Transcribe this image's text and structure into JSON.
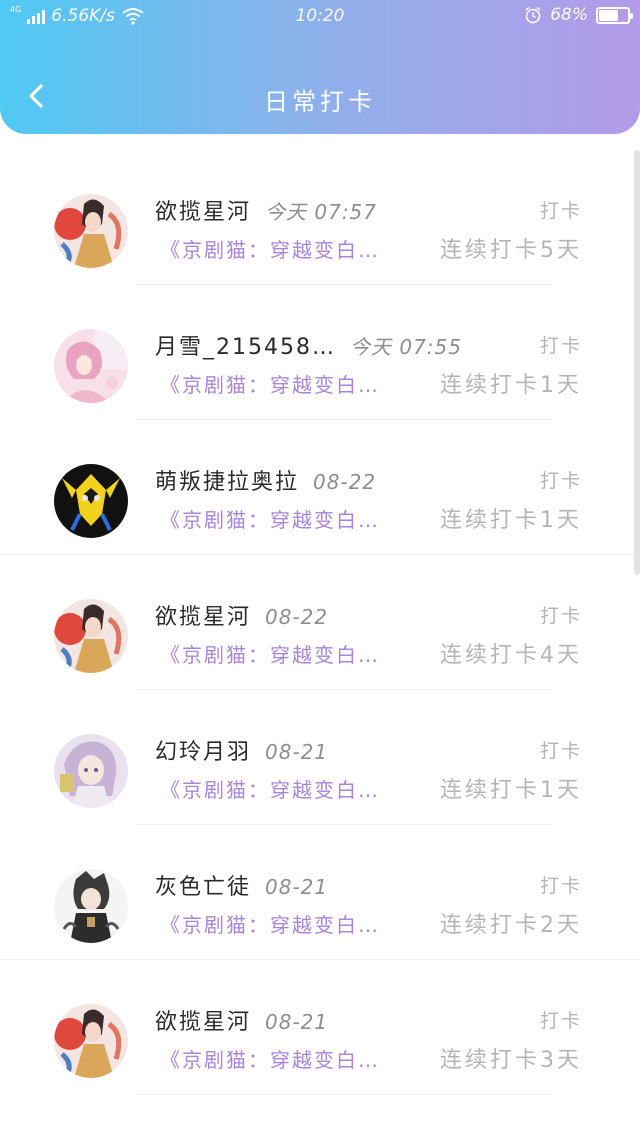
{
  "status_bar": {
    "network": "4G",
    "speed": "6.56K/s",
    "time": "10:20",
    "battery_level": "68%",
    "battery_fraction": 0.68
  },
  "nav": {
    "title": "日常打卡",
    "back_icon": "chevron-left-icon"
  },
  "colors": {
    "header_gradient_start": "#4fc9f3",
    "header_gradient_end": "#b39be9",
    "book_title": "#a885d9",
    "muted_text": "#b5b5b5"
  },
  "checkins": [
    {
      "name": "欲揽星河",
      "time": "今天 07:57",
      "action": "打卡",
      "book": "《京剧猫：穿越变白…",
      "streak": "连续打卡5天"
    },
    {
      "name": "月雪_215458…",
      "time": "今天 07:55",
      "action": "打卡",
      "book": "《京剧猫：穿越变白…",
      "streak": "连续打卡1天"
    },
    {
      "name": "萌叛捷拉奥拉",
      "time": "08-22",
      "action": "打卡",
      "book": "《京剧猫：穿越变白…",
      "streak": "连续打卡1天"
    },
    {
      "name": "欲揽星河",
      "time": "08-22",
      "action": "打卡",
      "book": "《京剧猫：穿越变白…",
      "streak": "连续打卡4天"
    },
    {
      "name": "幻玲月羽",
      "time": "08-21",
      "action": "打卡",
      "book": "《京剧猫：穿越变白…",
      "streak": "连续打卡1天"
    },
    {
      "name": "灰色亡徒",
      "time": "08-21",
      "action": "打卡",
      "book": "《京剧猫：穿越变白…",
      "streak": "连续打卡2天"
    },
    {
      "name": "欲揽星河",
      "time": "08-21",
      "action": "打卡",
      "book": "《京剧猫：穿越变白…",
      "streak": "连续打卡3天"
    }
  ]
}
